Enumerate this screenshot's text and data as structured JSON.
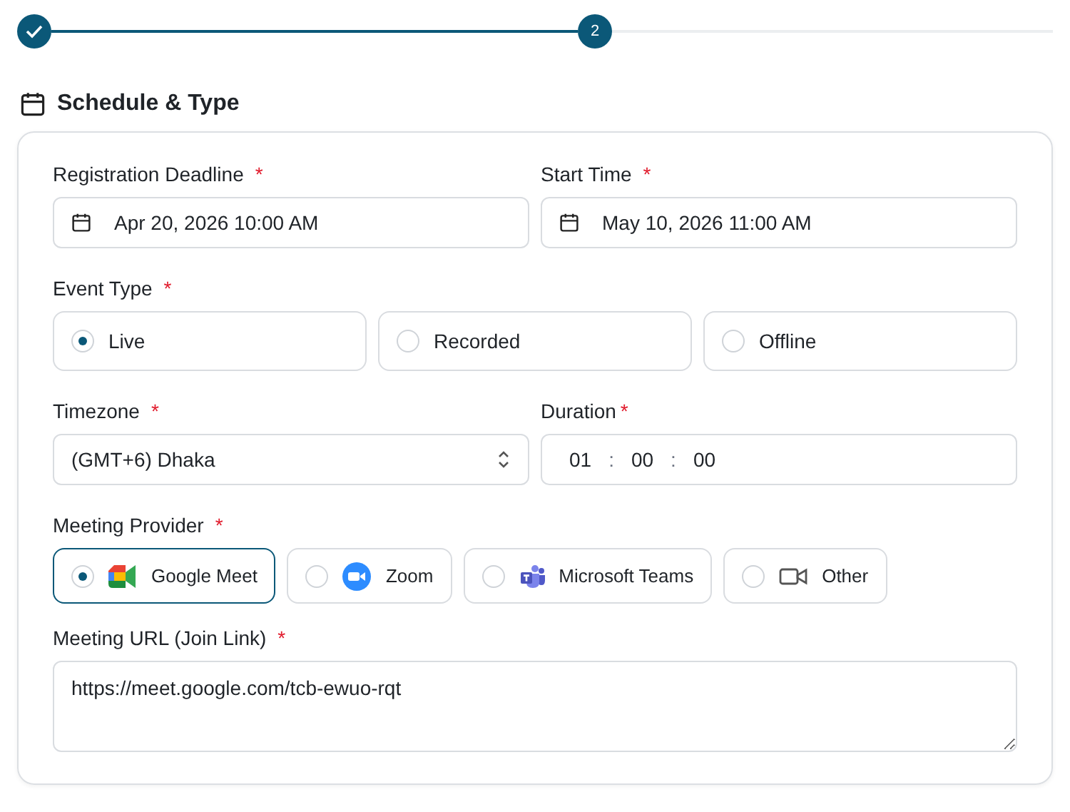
{
  "stepper": {
    "steps": [
      {
        "completed": true
      },
      {
        "completed": false,
        "number": "2"
      }
    ]
  },
  "section": {
    "title": "Schedule & Type"
  },
  "registration_deadline": {
    "label": "Registration Deadline",
    "mark": "*",
    "value": "Apr 20, 2026 10:00 AM"
  },
  "start_time": {
    "label": "Start Time",
    "mark": "*",
    "value": "May 10, 2026 11:00 AM"
  },
  "event_type": {
    "label": "Event Type",
    "mark": "*",
    "options": [
      {
        "label": "Live",
        "selected": true
      },
      {
        "label": "Recorded",
        "selected": false
      },
      {
        "label": "Offline",
        "selected": false
      }
    ]
  },
  "timezone": {
    "label": "Timezone",
    "mark": "*",
    "value": "(GMT+6) Dhaka"
  },
  "duration": {
    "label": "Duration",
    "mark": "*",
    "hours": "01",
    "separator_1": ":",
    "minutes": "00",
    "separator_2": ":",
    "seconds": "00"
  },
  "meeting_provider": {
    "label": "Meeting Provider",
    "mark": "*",
    "options": [
      {
        "label": "Google Meet",
        "kind": "meet",
        "selected": true
      },
      {
        "label": "Zoom",
        "kind": "zoom",
        "selected": false
      },
      {
        "label": "Microsoft Teams",
        "kind": "teams",
        "selected": false
      },
      {
        "label": "Other",
        "kind": "other",
        "selected": false
      }
    ]
  },
  "meeting_url": {
    "label": "Meeting URL (Join Link)",
    "mark": "*",
    "value": "https://meet.google.com/tcb-ewuo-rqt"
  }
}
